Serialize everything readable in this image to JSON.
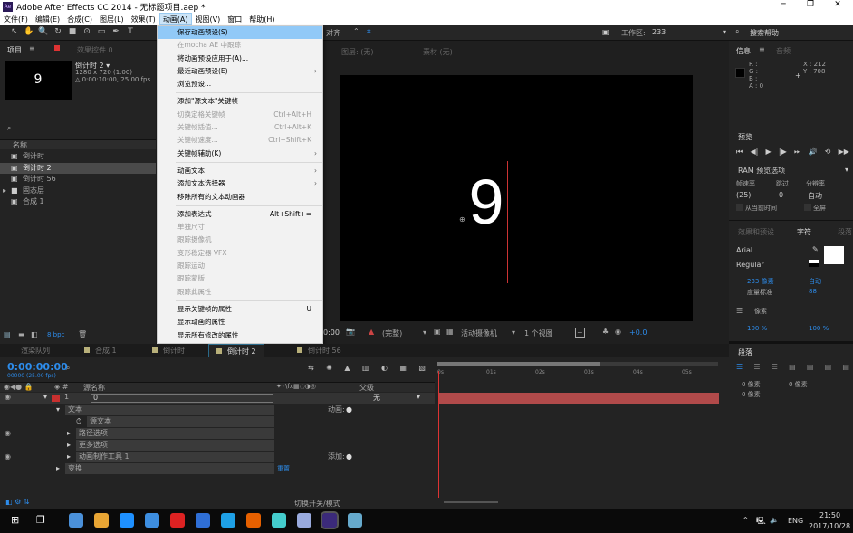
{
  "window": {
    "title": "Adobe After Effects CC 2014 - 无标题项目.aep *",
    "logo": "Ae"
  },
  "menubar": [
    "文件(F)",
    "编辑(E)",
    "合成(C)",
    "图层(L)",
    "效果(T)",
    "动画(A)",
    "视图(V)",
    "窗口",
    "帮助(H)"
  ],
  "toolbar": {
    "tools": [
      "selection-icon",
      "hand-icon",
      "zoom-icon",
      "rotate-icon",
      "camera-icon",
      "pan-behind-icon",
      "rectangle-icon",
      "pen-icon",
      "text-icon"
    ],
    "tool_glyphs": [
      "↖",
      "✋",
      "🔍",
      "↻",
      "■",
      "⊙",
      "▭",
      "✒",
      "T"
    ],
    "snap_label": "对齐",
    "workspace_label": "工作区:",
    "workspace_value": "233",
    "search_help": "搜索帮助"
  },
  "animation_menu": [
    {
      "label": "保存动画预设(S)",
      "state": "highlighted"
    },
    {
      "label": "在mocha AE 中跟踪",
      "state": "disabled"
    },
    {
      "label": "将动画预设应用于(A)..."
    },
    {
      "label": "最近动画预设(E)",
      "submenu": true
    },
    {
      "label": "浏览预设..."
    },
    {
      "sep": true
    },
    {
      "label": "添加\"源文本\"关键帧"
    },
    {
      "label": "切换定格关键帧",
      "shortcut": "Ctrl+Alt+H",
      "state": "disabled"
    },
    {
      "label": "关键帧插值...",
      "shortcut": "Ctrl+Alt+K",
      "state": "disabled"
    },
    {
      "label": "关键帧速度...",
      "shortcut": "Ctrl+Shift+K",
      "state": "disabled"
    },
    {
      "label": "关键帧辅助(K)",
      "submenu": true
    },
    {
      "sep": true
    },
    {
      "label": "动画文本",
      "submenu": true
    },
    {
      "label": "添加文本选择器",
      "submenu": true
    },
    {
      "label": "移除所有的文本动画器"
    },
    {
      "sep": true
    },
    {
      "label": "添加表达式",
      "shortcut": "Alt+Shift+="
    },
    {
      "label": "单独尺寸",
      "state": "disabled"
    },
    {
      "label": "跟踪摄像机",
      "state": "disabled"
    },
    {
      "label": "变形稳定器 VFX",
      "state": "disabled"
    },
    {
      "label": "跟踪运动",
      "state": "disabled"
    },
    {
      "label": "跟踪蒙版",
      "state": "disabled"
    },
    {
      "label": "跟踪此属性",
      "state": "disabled"
    },
    {
      "sep": true
    },
    {
      "label": "显示关键帧的属性",
      "shortcut": "U"
    },
    {
      "label": "显示动画的属性"
    },
    {
      "label": "显示所有修改的属性"
    }
  ],
  "project": {
    "tab": "项目",
    "effects_tab": "效果控件 0",
    "thumb_text": "9",
    "comp_name": "倒计时 2 ▾",
    "comp_size": "1280 x 720 (1.00)",
    "comp_duration": "△ 0:00:10:00, 25.00 fps",
    "col_name": "名称",
    "bpc": "8 bpc",
    "items": [
      {
        "name": "倒计时",
        "type": "comp"
      },
      {
        "name": "倒计时 2",
        "type": "comp",
        "selected": true
      },
      {
        "name": "倒计时 56",
        "type": "comp"
      },
      {
        "name": "固态层",
        "type": "folder"
      },
      {
        "name": "合成 1",
        "type": "comp"
      }
    ]
  },
  "viewer": {
    "layer_label": "图层: (无)",
    "footage_label": "素材 (无)",
    "glyph": "9",
    "time": "0:00",
    "quality": "(完整)",
    "camera": "活动摄像机",
    "views": "1 个视图",
    "exposure": "+0.0"
  },
  "info": {
    "tab": "信息",
    "audio_tab": "音频",
    "r": "R :",
    "g": "G :",
    "b": "B :",
    "a": "A : 0",
    "x": "X : 212",
    "y": "Y : 708"
  },
  "preview": {
    "tab": "预览",
    "ram_options": "RAM 预览选项",
    "fps_label": "帧速率",
    "skip_label": "跳过",
    "res_label": "分辨率",
    "fps": "(25)",
    "skip": "0",
    "res": "自动",
    "from_current": "从当前时间",
    "fullscreen": "全屏"
  },
  "character": {
    "effects_tab": "效果和预设",
    "tab": "字符",
    "para_short": "段落",
    "font": "Arial",
    "style": "Regular",
    "size": "233 像素",
    "leading": "自动",
    "kerning": "度量标准",
    "tracking": "88",
    "stroke_unit": "像素",
    "vscale": "100 %",
    "hscale": "100 %"
  },
  "paragraph": {
    "tab": "段落",
    "indent": "0 像素"
  },
  "timeline": {
    "tabs": [
      "渲染队列",
      "合成 1",
      "倒计时",
      "倒计时 2",
      "倒计时 56"
    ],
    "active_tab": 3,
    "timecode": "0:00:00:00",
    "frame_info": "00000 (25.00 fps)",
    "col_source": "源名称",
    "col_parent": "父级",
    "ruler": [
      "0s",
      "01s",
      "02s",
      "03s",
      "04s",
      "05s"
    ],
    "toggle_label": "切换开关/模式",
    "layer": {
      "num": "1",
      "name": "0",
      "parent": "无",
      "color": "#c8302f"
    },
    "props": [
      {
        "label": "文本",
        "indent": 1,
        "right": "动画:"
      },
      {
        "label": "源文本",
        "indent": 2,
        "stopwatch": true
      },
      {
        "label": "路径选项",
        "indent": 2
      },
      {
        "label": "更多选项",
        "indent": 2
      },
      {
        "label": "动画制作工具 1",
        "indent": 2,
        "right": "添加:"
      },
      {
        "label": "变换",
        "indent": 1,
        "reset": "重置"
      }
    ]
  },
  "taskbar": {
    "lang": "ENG",
    "time": "21:50",
    "date": "2017/10/28"
  },
  "colors": {
    "accent": "#2d8ceb",
    "menu_highlight": "#91c9f7",
    "layer_bar": "#b14a4a"
  }
}
